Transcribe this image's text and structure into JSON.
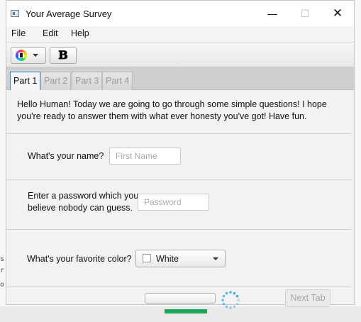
{
  "window": {
    "title": "Your Average Survey",
    "controls": {
      "minimize": "—",
      "maximize": "☐",
      "close": "✕"
    }
  },
  "menu": [
    "File",
    "Edit",
    "Help"
  ],
  "toolbar": {
    "color_button_icon": "color-wheel-icon",
    "bold_label": "B"
  },
  "tabs": [
    {
      "label": "Part 1",
      "active": true
    },
    {
      "label": "Part 2",
      "active": false
    },
    {
      "label": "Part 3",
      "active": false
    },
    {
      "label": "Part 4",
      "active": false
    }
  ],
  "part1": {
    "intro": "Hello Human! Today we are going to go through some simple questions! I hope you're ready to answer them with what ever honesty you've got! Have fun.",
    "name_label": "What's your name?",
    "name_placeholder": "First Name",
    "password_label_line1": "Enter a password which you",
    "password_label_line2": "believe nobody can guess.",
    "password_placeholder": "Password",
    "color_label": "What's your favorite color?",
    "color_value": "White",
    "color_swatch": "#ffffff",
    "next_button": "Next Tab"
  },
  "colors": {
    "active_tab_border": "#3f8ed6",
    "spinner": "#2aa8e0"
  }
}
